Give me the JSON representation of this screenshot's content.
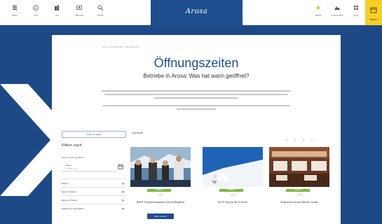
{
  "nav": {
    "left": [
      {
        "label": "Menu",
        "icon": "menu-icon"
      },
      {
        "label": "Info",
        "icon": "info-icon"
      },
      {
        "label": "Live",
        "icon": "buildings-icon"
      },
      {
        "label": "Webcam",
        "icon": "webcam-icon"
      },
      {
        "label": "Suche",
        "icon": "search-icon"
      }
    ],
    "brand": "Arosa",
    "right": [
      {
        "label": "Wetter",
        "icon": "sun-icon"
      },
      {
        "label": "Lenzerheide",
        "icon": "mountain-icon"
      },
      {
        "label": "Shop",
        "icon": "grid-icon"
      }
    ],
    "booking_label": "Buchen"
  },
  "page": {
    "breadcrumb": "Home  ›  Ferienplanung  ›  Öffnungszeiten",
    "title": "Öffnungszeiten",
    "subtitle": "Betriebe in Arosa: Was hat wann geöffnet?"
  },
  "sidebar": {
    "button_label": "Karte anzeigen",
    "title": "Filtern nach",
    "date_section_label": "Was hat wann geöffnet?",
    "date_field_label": "Datum",
    "date_placeholder": "TT.MM.JJJJ",
    "filters": [
      "Region",
      "Sport & Freizeit",
      "Essen & Trinken",
      "Wellness & Gesundheit"
    ]
  },
  "results": {
    "label": "Ergebnisse",
    "cards": [
      {
        "name": "BÄRT Partnerrestaurant Hörnli Bergfahrt",
        "badge": "Geöffnet",
        "location": "Arosa",
        "button": "Mehr erfahren"
      },
      {
        "name": "ALTO Sports Ski & Snow",
        "badge": "Geöffnet",
        "location": "Arosa",
        "button": ""
      },
      {
        "name": "Kulinarium Arosa Kitchen Grabs",
        "badge": "Geöffnet",
        "location": "Arosa",
        "button": ""
      }
    ]
  },
  "colors": {
    "brand_blue": "#1f4e8f",
    "accent_yellow": "#f6cf22",
    "open_green": "#7dba3c",
    "background": "#1d4a86"
  }
}
